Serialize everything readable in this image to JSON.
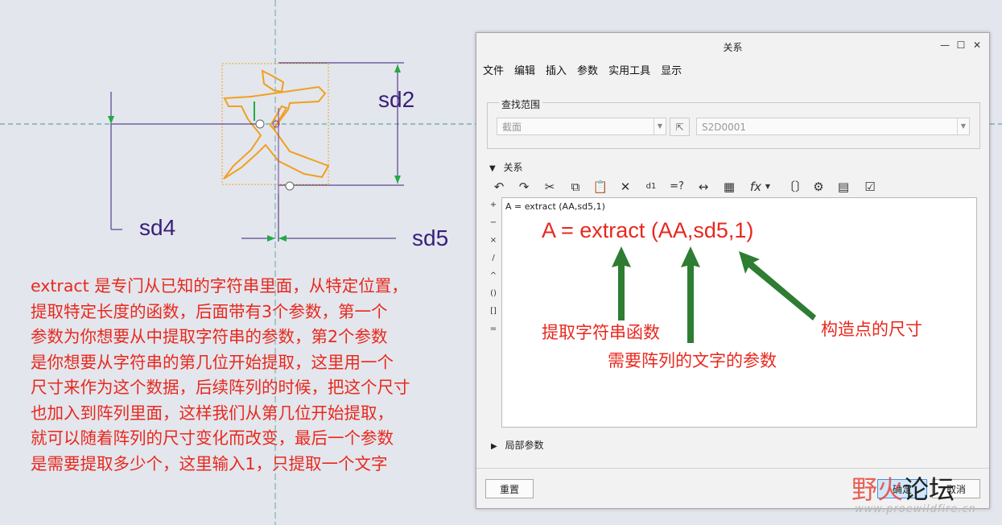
{
  "sketch": {
    "character": "文",
    "dims": {
      "sd2": "sd2",
      "sd4": "sd4",
      "sd5": "sd5"
    }
  },
  "explanation": [
    "extract 是专门从已知的字符串里面，从特定位置，",
    "提取特定长度的函数，后面带有3个参数，第一个",
    "参数为你想要从中提取字符串的参数，第2个参数",
    "是你想要从字符串的第几位开始提取，这里用一个",
    "尺寸来作为这个数据，后续阵列的时候，把这个尺寸",
    "也加入到阵列里面，这样我们从第几位开始提取，",
    "就可以随着阵列的尺寸变化而改变，最后一个参数",
    "是需要提取多少个，这里输入1，只提取一个文字"
  ],
  "dialog": {
    "title": "关系",
    "menu": [
      "文件",
      "编辑",
      "插入",
      "参数",
      "实用工具",
      "显示"
    ],
    "lookup": {
      "group_title": "查找范围",
      "type_value": "截面",
      "object_value": "S2D0001"
    },
    "relations_section": "关系",
    "operators": [
      "+",
      "−",
      "×",
      "/",
      "^",
      "()",
      "[]",
      "="
    ],
    "editor_text": "A = extract (AA,sd5,1)",
    "local_params_section": "局部参数",
    "buttons": {
      "reset": "重置",
      "ok": "确定",
      "cancel": "取消"
    }
  },
  "annotations": {
    "formula": "A = extract (AA,sd5,1)",
    "label_function": "提取字符串函数",
    "label_param": "需要阵列的文字的参数",
    "label_dim": "构造点的尺寸"
  },
  "watermark": {
    "part1": "野火",
    "part2": "论坛",
    "url": "www.proewildfire.cn"
  },
  "colors": {
    "annotation_red": "#e8281e",
    "arrow_green": "#2e7d32",
    "sketch_orange": "#f0a020",
    "dim_purple": "#3a1e7a"
  }
}
